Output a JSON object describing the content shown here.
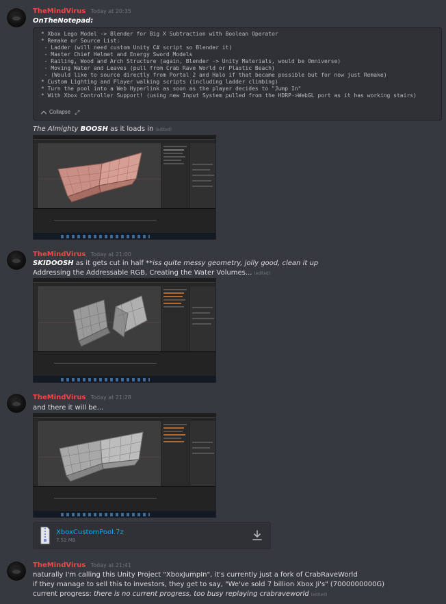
{
  "messages": [
    {
      "username": "TheMindVirus",
      "timestamp": "Today at 20:35",
      "title": "OnTheNotepad:",
      "code_lines": [
        " * Xbox Lego Model -> Blender for Big X Subtraction with Boolean Operator",
        " * Remake or Source List:",
        "  - Ladder (will need custom Unity C# script so Blender it)",
        "  - Master Chief Helmet and Energy Sword Models",
        "  - Railing, Wood and Arch Structure (again, Blender -> Unity Materials, would be Omniverse)",
        "  - Moving Water and Leaves (pull from Crab Rave World or Plastic Beach)",
        "  - (Would like to source directly from Portal 2 and Halo if that became possible but for now just Remake)",
        " * Custom Lighting and Player walking scripts (including ladder climbing)",
        " * Turn the pool into a Web Hyperlink as soon as the player decides to \"Jump In\"",
        " * With Xbox Controller Support! (using new Input System pulled from the HDRP->WebGL port as it has working stairs)"
      ],
      "collapse_label": "Collapse",
      "caption_bold": "The Almighty BOOSH",
      "caption_bold_a": "The Almighty ",
      "caption_bold_b": "BOOSH",
      "caption_rest": " as it loads in",
      "edited": "(edited)"
    },
    {
      "username": "TheMindVirus",
      "timestamp": "Today at 21:00",
      "line1_bold": "SKIDOOSH",
      "line1_rest": " as it gets cut in half ",
      "line1_italic": "**iss quite messy geometry, jolly good, clean it up",
      "line2": "Addressing the Addressable RGB, Creating the Water Volumes...",
      "edited": "(edited)"
    },
    {
      "username": "TheMindVirus",
      "timestamp": "Today at 21:28",
      "line1": "and there it will be...",
      "attachment": {
        "file_name": "XboxCustomPool.7z",
        "file_size": "7.52 MB"
      }
    },
    {
      "username": "TheMindVirus",
      "timestamp": "Today at 21:41",
      "line1": "naturally I'm calling this Unity Project \"XboxJumpIn\", it's currently just a fork of CrabRaveWorld",
      "line2": "if they manage to sell this to investors, they get to say, \"We've sold 7 billion Xbox Ji's\" (7000000000G)",
      "line3_plain": "current progress: ",
      "line3_italic": "there is no current progress, too busy replaying crabraveworld",
      "edited": "(edited)"
    }
  ],
  "colors": {
    "background": "#36393f",
    "username": "#f04747",
    "link": "#00b0f4",
    "muted": "#72767d",
    "code_bg": "#2f3136"
  },
  "icons": [
    "avatar",
    "chevron-up-icon",
    "expand-icon",
    "zip-file-icon",
    "download-icon"
  ]
}
